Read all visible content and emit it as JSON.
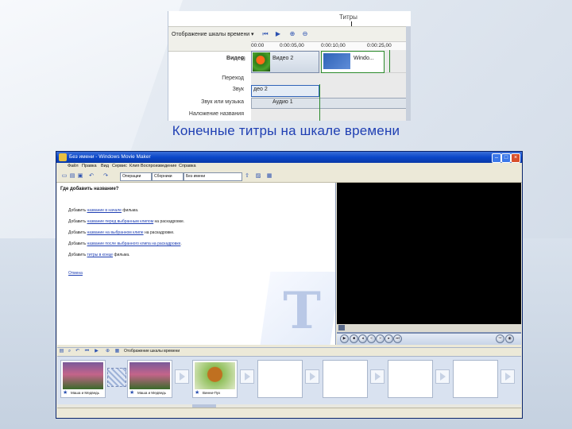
{
  "timeline_crop": {
    "mode_label": "Отображение шкалы времени",
    "titles_pointer_label": "Титры",
    "ticks": [
      "00:00",
      "0:00:05,00",
      "0:00:10,00",
      "0:00:25,00"
    ],
    "tracks": {
      "video": "Видео",
      "transition": "Переход",
      "audio": "Звук",
      "music": "Звук или музыка",
      "title_overlay": "Наложение названия"
    },
    "clips": {
      "video_clip_1": "Видео 2",
      "video_clip_2": "Windo...",
      "audio_clip": "део 2",
      "music_clip": "Аудио 1"
    }
  },
  "caption": "Конечные титры на шкале времени",
  "app": {
    "window_title": "Без имени - Windows Movie Maker",
    "menu": [
      "Файл",
      "Правка",
      "Вид",
      "Сервис",
      "Клип",
      "Воспроизведение",
      "Справка"
    ],
    "toolbar": {
      "tasks_label": "Операции",
      "collections_label": "Сборники",
      "collection_value": "Без имени"
    },
    "task_pane": {
      "heading": "Где добавить название?",
      "lines": [
        {
          "pre": "Добавить ",
          "link": "название в начале",
          "post": " фильма."
        },
        {
          "pre": "Добавить ",
          "link": "название перед выбранным клипом",
          "post": " на раскадровке."
        },
        {
          "pre": "Добавить ",
          "link": "название на выбранном клипе",
          "post": " на раскадровке."
        },
        {
          "pre": "Добавить ",
          "link": "название после выбранного клипа на раскадровке",
          "post": "."
        },
        {
          "pre": "Добавить ",
          "link": "титры в конце",
          "post": " фильма."
        }
      ],
      "cancel": "Отмена"
    },
    "storyboard": {
      "toolbar_label": "Отображение шкалы времени",
      "clips": [
        {
          "caption": "Маша и Медведь"
        },
        {
          "caption": "Маша и Медведь"
        },
        {
          "caption": "Винни-Пух"
        }
      ]
    }
  },
  "colors": {
    "caption": "#1f3fb3",
    "titlebar": "#0a46c8",
    "accent_green": "#2b8a2b"
  }
}
